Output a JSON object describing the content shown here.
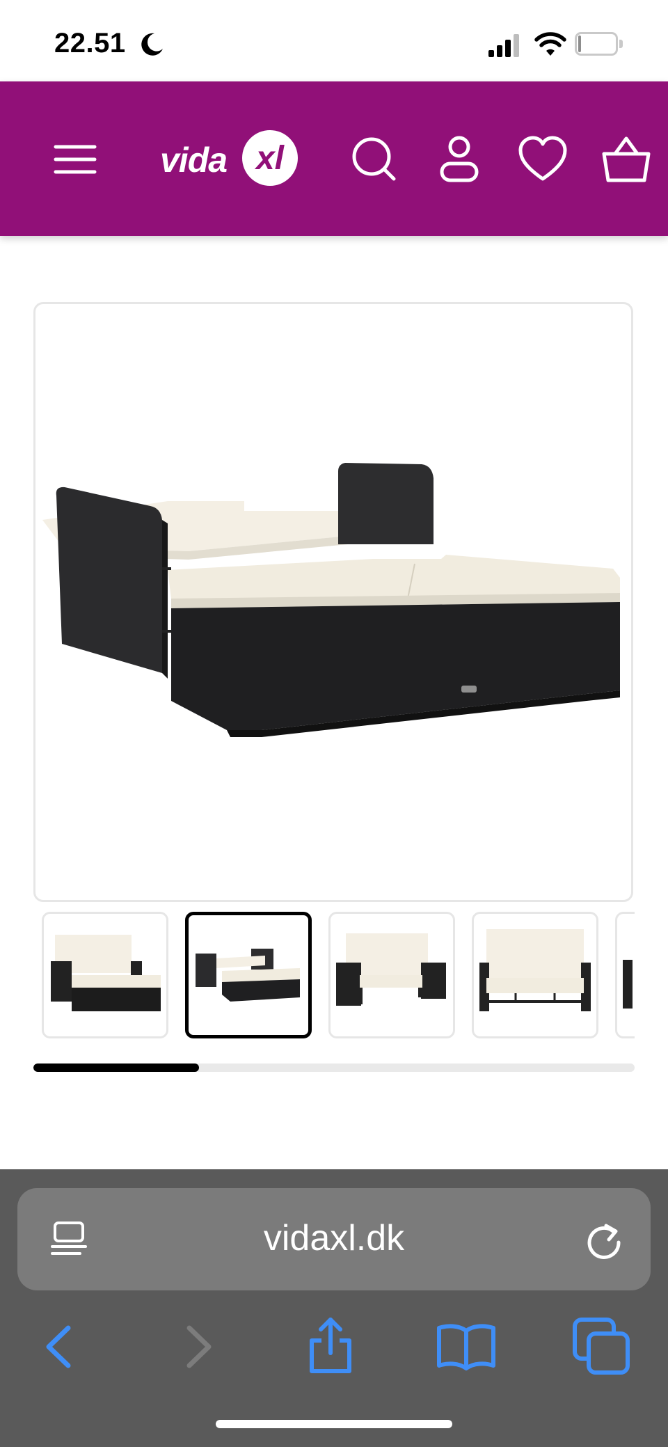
{
  "status_bar": {
    "time": "22.51",
    "battery_level": "4",
    "battery_fraction": 0.04,
    "icons": [
      "moon-icon",
      "cellular-signal-icon",
      "wifi-icon",
      "battery-icon"
    ]
  },
  "header": {
    "brand_color": "#911078",
    "logo_text": "vida",
    "logo_mark": "xl",
    "icons": [
      "menu-icon",
      "search-icon",
      "account-icon",
      "wishlist-heart-icon",
      "cart-icon"
    ]
  },
  "gallery": {
    "thumbnails": [
      "thumbnail-1",
      "thumbnail-2",
      "thumbnail-3",
      "thumbnail-4",
      "thumbnail-5"
    ],
    "active_thumbnail": 2,
    "scroll_progress": 0.275
  },
  "browser": {
    "url": "vidaxl.dk",
    "chrome_color": "#5a5a5a",
    "accent_color": "#3f8ef7",
    "icons": [
      "reader-mode-icon",
      "reload-icon",
      "back-icon",
      "forward-icon",
      "share-icon",
      "bookmarks-icon",
      "tabs-icon"
    ]
  }
}
